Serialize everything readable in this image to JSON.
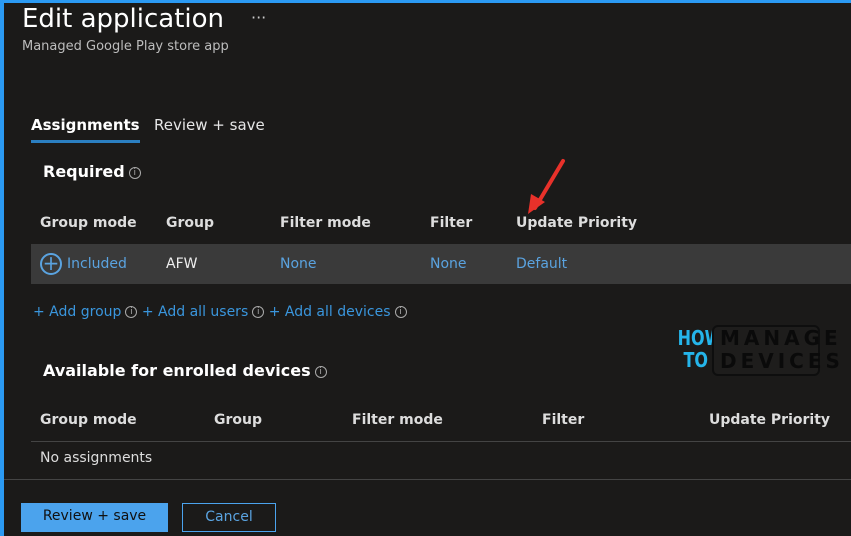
{
  "header": {
    "title": "Edit application",
    "more": "···",
    "subtitle": "Managed Google Play store app"
  },
  "tabs": [
    {
      "label": "Assignments",
      "active": true
    },
    {
      "label": "Review + save",
      "active": false
    }
  ],
  "required": {
    "title": "Required",
    "columns": [
      "Group mode",
      "Group",
      "Filter mode",
      "Filter",
      "Update Priority"
    ],
    "rows": [
      {
        "group_mode": "Included",
        "group": "AFW",
        "filter_mode": "None",
        "filter": "None",
        "update_priority": "Default"
      }
    ],
    "links": [
      "+ Add group",
      "+ Add all users",
      "+ Add all devices"
    ]
  },
  "available": {
    "title": "Available for enrolled devices",
    "columns": [
      "Group mode",
      "Group",
      "Filter mode",
      "Filter",
      "Update Priority"
    ],
    "empty": "No assignments"
  },
  "footer": {
    "review_save": "Review + save",
    "cancel": "Cancel"
  },
  "logo": {
    "text1": "HOW",
    "text2": "TO",
    "text3": "MANAGE",
    "text4": "DEVICES"
  },
  "colors": {
    "accent": "#2b9af3",
    "link": "#3a96dd",
    "arrow": "#e8312a"
  }
}
